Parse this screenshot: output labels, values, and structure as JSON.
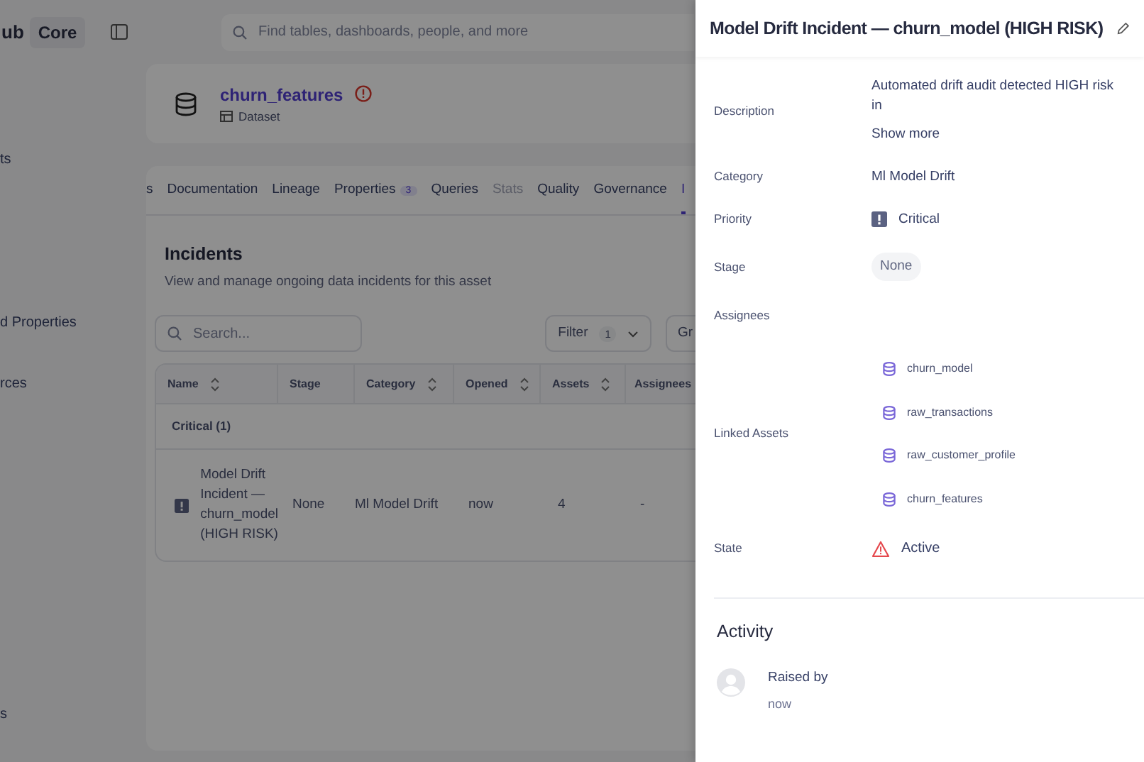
{
  "header": {
    "brand": "ub",
    "brand_badge": "Core",
    "search": {
      "placeholder": "Find tables, dashboards, people, and more"
    }
  },
  "sidebar": {
    "items": [
      {
        "label": "ts"
      },
      {
        "label": "d Properties"
      },
      {
        "label": "rces"
      },
      {
        "label": "s"
      }
    ]
  },
  "asset": {
    "name": "churn_features",
    "type": "Dataset",
    "warning": true
  },
  "tabs": [
    {
      "label": "s",
      "selected": false,
      "disabled": false
    },
    {
      "label": "Documentation",
      "selected": false,
      "disabled": false
    },
    {
      "label": "Lineage",
      "selected": false,
      "disabled": false
    },
    {
      "label": "Properties",
      "count": "3",
      "selected": false,
      "disabled": false
    },
    {
      "label": "Queries",
      "selected": false,
      "disabled": false
    },
    {
      "label": "Stats",
      "selected": false,
      "disabled": true
    },
    {
      "label": "Quality",
      "selected": false,
      "disabled": false
    },
    {
      "label": "Governance",
      "selected": false,
      "disabled": false
    },
    {
      "label": "I",
      "selected": true,
      "disabled": false
    }
  ],
  "incidents": {
    "title": "Incidents",
    "subtitle": "View and manage ongoing data incidents for this asset",
    "search": {
      "placeholder": "Search..."
    },
    "filter": {
      "label": "Filter",
      "count": "1"
    },
    "group_button": "Gr",
    "table": {
      "columns": [
        {
          "label": "Name",
          "sortable": true
        },
        {
          "label": "Stage",
          "sortable": false
        },
        {
          "label": "Category",
          "sortable": true
        },
        {
          "label": "Opened",
          "sortable": true
        },
        {
          "label": "Assets",
          "sortable": true
        },
        {
          "label": "Assignees"
        }
      ],
      "groups": [
        {
          "label": "Critical (1)",
          "rows": [
            {
              "name": "Model Drift Incident — churn_model (HIGH RISK)",
              "stage": "None",
              "category": "Ml Model Drift",
              "opened": "now",
              "assets": "4",
              "assignees": "-"
            }
          ]
        }
      ]
    }
  },
  "drawer": {
    "title": "Model Drift Incident — churn_model (HIGH RISK)",
    "fields": [
      {
        "kind": "text",
        "label": "Description",
        "value": "Automated drift audit detected HIGH risk in",
        "link": "Show more"
      },
      {
        "kind": "text",
        "label": "Category",
        "value": "Ml Model Drift"
      },
      {
        "kind": "priority",
        "label": "Priority",
        "value": "Critical"
      },
      {
        "kind": "pill",
        "label": "Stage",
        "value": "None"
      },
      {
        "kind": "empty",
        "label": "Assignees"
      },
      {
        "kind": "assets",
        "label": "Linked Assets",
        "items": [
          "churn_model",
          "raw_transactions",
          "raw_customer_profile",
          "churn_features"
        ]
      },
      {
        "kind": "state",
        "label": "State",
        "value": "Active"
      }
    ],
    "activity": {
      "title": "Activity",
      "entries": [
        {
          "text": "Raised by",
          "time": "now"
        }
      ]
    }
  }
}
